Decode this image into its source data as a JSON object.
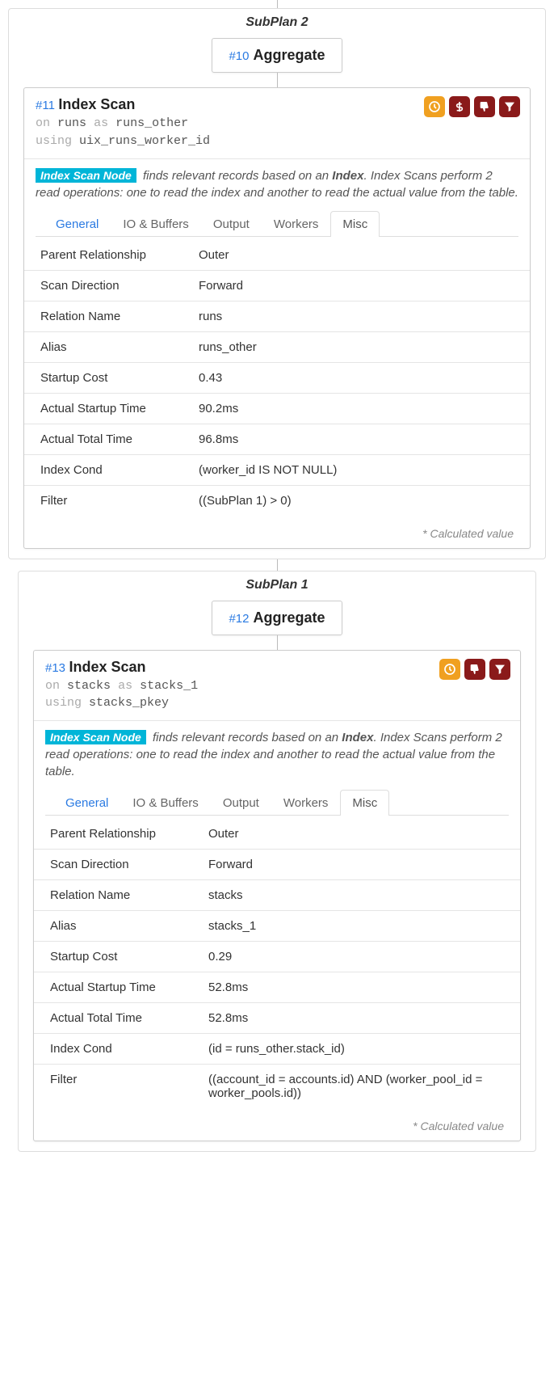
{
  "subplan2": {
    "title": "SubPlan 2",
    "agg": {
      "id": "#10",
      "name": "Aggregate"
    },
    "scan": {
      "id": "#11",
      "name": "Index Scan",
      "meta_on": "on",
      "meta_rel": "runs",
      "meta_as": "as",
      "meta_alias": "runs_other",
      "meta_using": "using",
      "meta_idx": "uix_runs_worker_id",
      "badges": [
        "clock",
        "dollar",
        "thumbsdown",
        "filter"
      ],
      "desc_tag": "Index Scan Node",
      "desc_pre": "finds relevant records based on an ",
      "desc_bold": "Index",
      "desc_post": ". Index Scans perform 2 read operations: one to read the index and another to read the actual value from the table.",
      "tabs": [
        "General",
        "IO & Buffers",
        "Output",
        "Workers",
        "Misc"
      ],
      "rows": [
        {
          "k": "Parent Relationship",
          "v": "Outer"
        },
        {
          "k": "Scan Direction",
          "v": "Forward"
        },
        {
          "k": "Relation Name",
          "v": "runs"
        },
        {
          "k": "Alias",
          "v": "runs_other"
        },
        {
          "k": "Startup Cost",
          "v": "0.43"
        },
        {
          "k": "Actual Startup Time",
          "v": "90.2ms"
        },
        {
          "k": "Actual Total Time",
          "v": "96.8ms"
        },
        {
          "k": "Index Cond",
          "v": "(worker_id IS NOT NULL)"
        },
        {
          "k": "Filter",
          "v": "((SubPlan 1) > 0)"
        }
      ],
      "footnote": "* Calculated value"
    }
  },
  "subplan1": {
    "title": "SubPlan 1",
    "agg": {
      "id": "#12",
      "name": "Aggregate"
    },
    "scan": {
      "id": "#13",
      "name": "Index Scan",
      "meta_on": "on",
      "meta_rel": "stacks",
      "meta_as": "as",
      "meta_alias": "stacks_1",
      "meta_using": "using",
      "meta_idx": "stacks_pkey",
      "badges": [
        "clock",
        "thumbsdown",
        "filter"
      ],
      "desc_tag": "Index Scan Node",
      "desc_pre": "finds relevant records based on an ",
      "desc_bold": "Index",
      "desc_post": ". Index Scans perform 2 read operations: one to read the index and another to read the actual value from the table.",
      "tabs": [
        "General",
        "IO & Buffers",
        "Output",
        "Workers",
        "Misc"
      ],
      "rows": [
        {
          "k": "Parent Relationship",
          "v": "Outer"
        },
        {
          "k": "Scan Direction",
          "v": "Forward"
        },
        {
          "k": "Relation Name",
          "v": "stacks"
        },
        {
          "k": "Alias",
          "v": "stacks_1"
        },
        {
          "k": "Startup Cost",
          "v": "0.29"
        },
        {
          "k": "Actual Startup Time",
          "v": "52.8ms"
        },
        {
          "k": "Actual Total Time",
          "v": "52.8ms"
        },
        {
          "k": "Index Cond",
          "v": "(id = runs_other.stack_id)"
        },
        {
          "k": "Filter",
          "v": "((account_id = accounts.id) AND (worker_pool_id = worker_pools.id))"
        }
      ],
      "footnote": "* Calculated value"
    }
  }
}
